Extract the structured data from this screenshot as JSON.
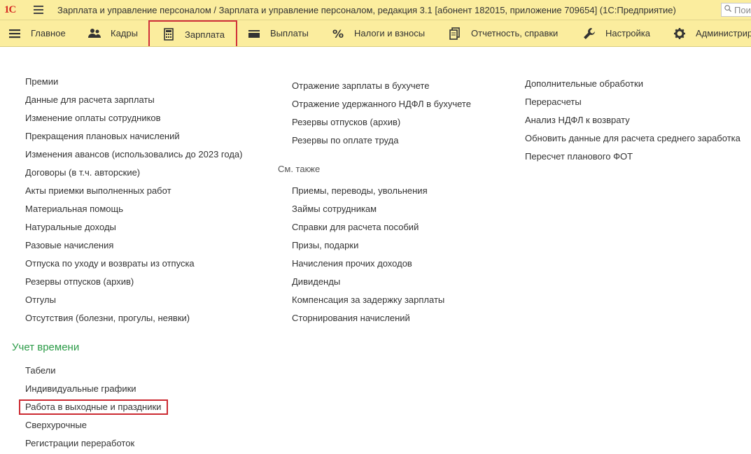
{
  "titlebar": {
    "logo": "1С",
    "title": "Зарплата и управление персоналом / Зарплата и управление персоналом, редакция 3.1 [абонент 182015, приложение 709654]  (1С:Предприятие)",
    "search_placeholder": "Поиск"
  },
  "menu": {
    "items": [
      {
        "label": "Главное"
      },
      {
        "label": "Кадры"
      },
      {
        "label": "Зарплата"
      },
      {
        "label": "Выплаты"
      },
      {
        "label": "Налоги и взносы"
      },
      {
        "label": "Отчетность, справки"
      },
      {
        "label": "Настройка"
      },
      {
        "label": "Администрирование"
      }
    ]
  },
  "col1": {
    "items": [
      "Премии",
      "Данные для расчета зарплаты",
      "Изменение оплаты сотрудников",
      "Прекращения плановых начислений",
      "Изменения авансов (использовались до 2023 года)",
      "Договоры (в т.ч. авторские)",
      "Акты приемки выполненных работ",
      "Материальная помощь",
      "Натуральные доходы",
      "Разовые начисления",
      "Отпуска по уходу и возвраты из отпуска",
      "Резервы отпусков (архив)",
      "Отгулы",
      "Отсутствия (болезни, прогулы, неявки)"
    ],
    "section_title": "Учет времени",
    "section_items": [
      "Табели",
      "Индивидуальные графики",
      "Работа в выходные и праздники",
      "Сверхурочные",
      "Регистрации переработок"
    ]
  },
  "col2": {
    "items": [
      "Отражение зарплаты в бухучете",
      "Отражение удержанного НДФЛ в бухучете",
      "Резервы отпусков (архив)",
      "Резервы по оплате труда"
    ],
    "see_also": "См. также",
    "see_also_items": [
      "Приемы, переводы, увольнения",
      "Займы сотрудникам",
      "Справки для расчета пособий",
      "Призы, подарки",
      "Начисления прочих доходов",
      "Дивиденды",
      "Компенсация за задержку зарплаты",
      "Сторнирования начислений"
    ]
  },
  "col3": {
    "items": [
      "Дополнительные обработки",
      "Перерасчеты",
      "Анализ НДФЛ к возврату",
      "Обновить данные для расчета среднего заработка",
      "Пересчет планового ФОТ"
    ]
  },
  "colors": {
    "bar": "#fbed9e",
    "accent_green": "#2b9b47",
    "highlight_red": "#cc2a32",
    "logo_red": "#d62a22"
  }
}
